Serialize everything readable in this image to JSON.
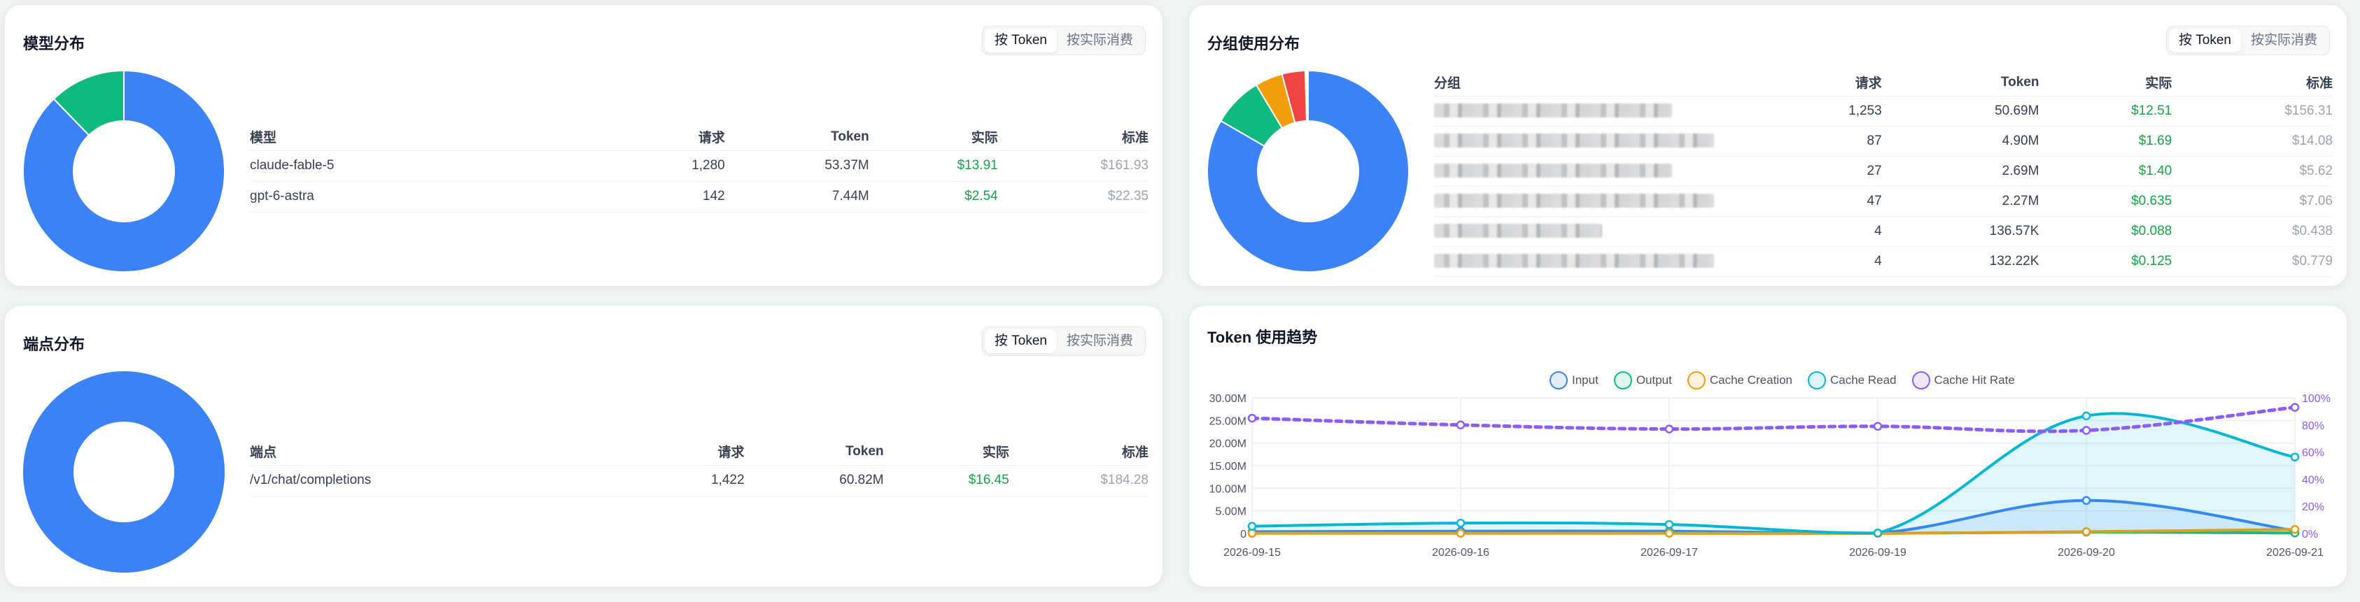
{
  "toggle": {
    "token_label": "按 Token",
    "cost_label": "按实际消费"
  },
  "colors": {
    "blue": "#3b82f6",
    "green": "#10b981",
    "orange": "#f59e0b",
    "red": "#ef4444",
    "cyan": "#06b6d4",
    "purple": "#8b5cf6"
  },
  "model_card": {
    "title": "模型分布",
    "headers": [
      "模型",
      "请求",
      "Token",
      "实际",
      "标准"
    ],
    "rows": [
      [
        "claude-fable-5",
        "1,280",
        "53.37M",
        "$13.91",
        "$161.93"
      ],
      [
        "gpt-6-astra",
        "142",
        "7.44M",
        "$2.54",
        "$22.35"
      ]
    ],
    "slices": [
      {
        "name": "claude-fable-5",
        "value": 53.37,
        "color": "#3b82f6"
      },
      {
        "name": "gpt-6-astra",
        "value": 7.44,
        "color": "#10b981"
      }
    ]
  },
  "group_card": {
    "title": "分组使用分布",
    "headers": [
      "分组",
      "请求",
      "Token",
      "实际",
      "标准"
    ],
    "rows": [
      [
        "",
        "1,253",
        "50.69M",
        "$12.51",
        "$156.31"
      ],
      [
        "",
        "87",
        "4.90M",
        "$1.69",
        "$14.08"
      ],
      [
        "",
        "27",
        "2.69M",
        "$1.40",
        "$5.62"
      ],
      [
        "",
        "47",
        "2.27M",
        "$0.635",
        "$7.06"
      ],
      [
        "",
        "4",
        "136.57K",
        "$0.088",
        "$0.438"
      ],
      [
        "",
        "4",
        "132.22K",
        "$0.125",
        "$0.779"
      ]
    ],
    "slices": [
      {
        "name": "",
        "value": 50.69,
        "color": "#3b82f6"
      },
      {
        "name": "",
        "value": 4.9,
        "color": "#10b981"
      },
      {
        "name": "",
        "value": 2.69,
        "color": "#f59e0b"
      },
      {
        "name": "",
        "value": 2.27,
        "color": "#ef4444"
      },
      {
        "name": "",
        "value": 0.137,
        "color": "#8b5cf6"
      },
      {
        "name": "",
        "value": 0.132,
        "color": "#ec4899"
      }
    ]
  },
  "endpoint_card": {
    "title": "端点分布",
    "headers": [
      "端点",
      "请求",
      "Token",
      "实际",
      "标准"
    ],
    "rows": [
      [
        "/v1/chat/completions",
        "1,422",
        "60.82M",
        "$16.45",
        "$184.28"
      ]
    ],
    "slices": [
      {
        "name": "/v1/chat/completions",
        "value": 60.82,
        "color": "#3b82f6"
      }
    ]
  },
  "trend_card": {
    "title": "Token 使用趋势"
  },
  "chart_data": {
    "type": "line",
    "x": [
      "2026-09-15",
      "2026-09-16",
      "2026-09-17",
      "2026-09-19",
      "2026-09-20",
      "2026-09-21"
    ],
    "yticks": [
      "30.00M",
      "25.00M",
      "20.00M",
      "15.00M",
      "10.00M",
      "5.00M",
      "0"
    ],
    "y2ticks": [
      "100%",
      "80%",
      "60%",
      "40%",
      "20%",
      "0%"
    ],
    "ylim": [
      0,
      30
    ],
    "y2lim": [
      0,
      100
    ],
    "series": [
      {
        "name": "Input",
        "values": [
          0.4,
          0.5,
          0.5,
          0.1,
          7.3,
          0.6
        ],
        "color": "#3b82f6",
        "axis": "left"
      },
      {
        "name": "Output",
        "values": [
          0.05,
          0.05,
          0.05,
          0.02,
          0.3,
          0.1
        ],
        "color": "#10b981",
        "axis": "left"
      },
      {
        "name": "Cache Creation",
        "values": [
          0.05,
          0.05,
          0.05,
          0.02,
          0.4,
          0.9
        ],
        "color": "#f59e0b",
        "axis": "left"
      },
      {
        "name": "Cache Read",
        "values": [
          1.6,
          2.3,
          2.0,
          0.1,
          26.0,
          16.9
        ],
        "color": "#06b6d4",
        "axis": "left"
      },
      {
        "name": "Cache Hit Rate",
        "values": [
          85,
          80,
          77,
          79,
          76,
          93
        ],
        "color": "#8b5cf6",
        "axis": "right",
        "dashed": true
      }
    ],
    "legend_position": "top"
  }
}
